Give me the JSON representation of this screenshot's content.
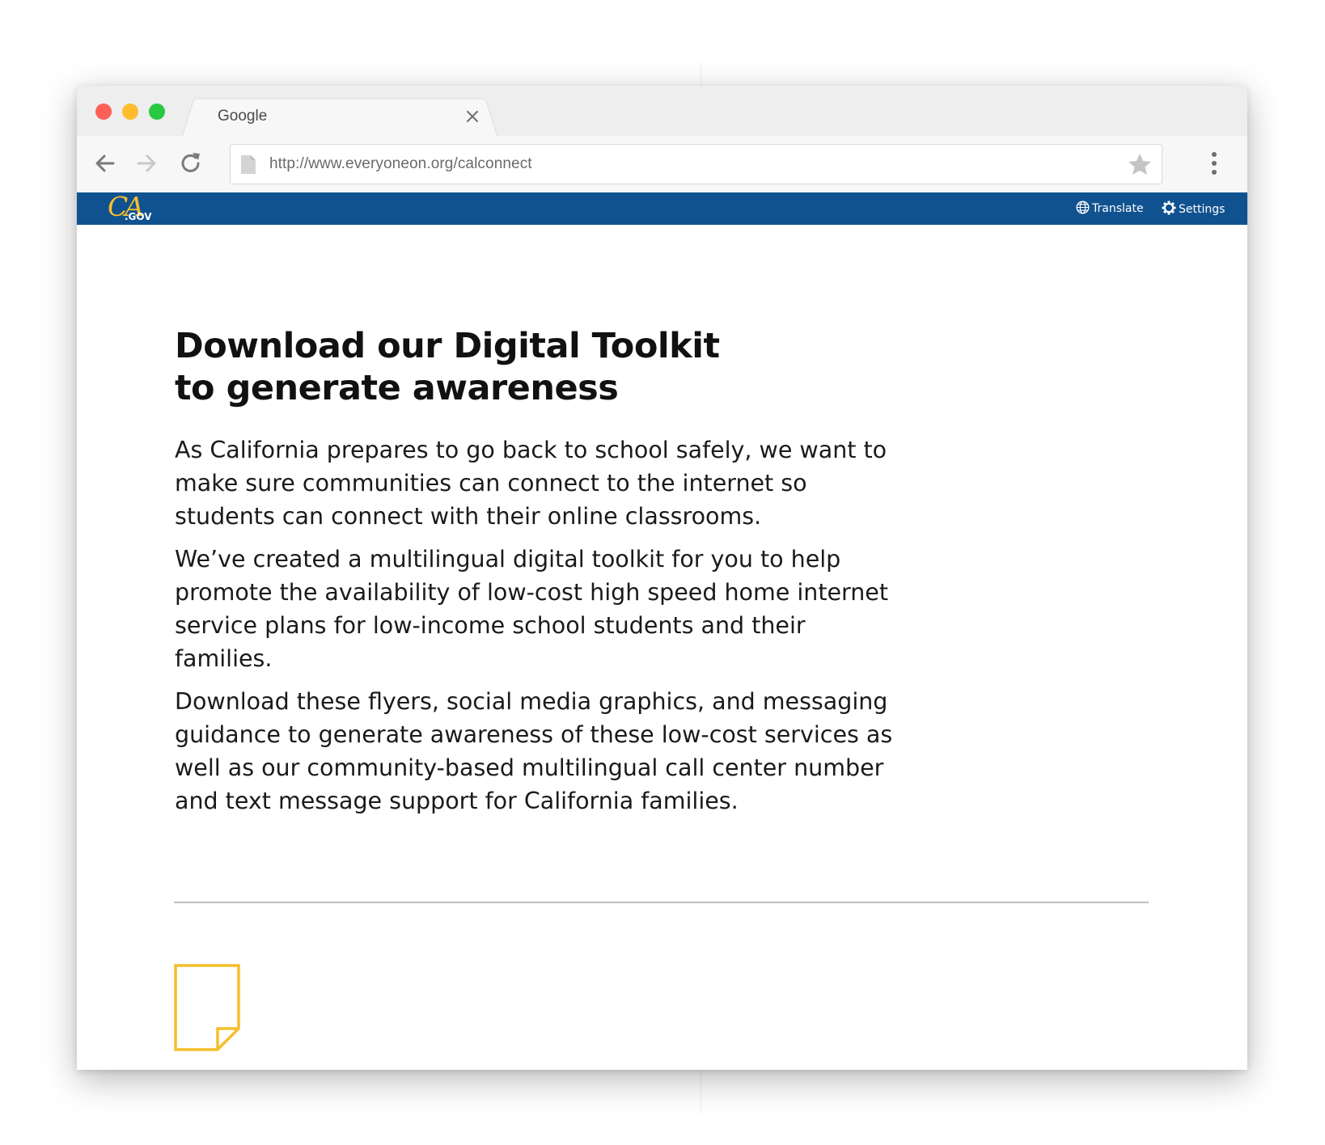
{
  "browser": {
    "tab_title": "Google",
    "url": "http://www.everyoneon.org/calconnect"
  },
  "site_header": {
    "logo_mark": "CA",
    "logo_suffix": ".GOV",
    "translate_label": "Translate",
    "settings_label": "Settings"
  },
  "main": {
    "headline_line1": "Download our Digital Toolkit",
    "headline_line2": "to generate awareness",
    "paragraphs": [
      "As California prepares to go back to school safely, we want to make sure communities can connect to the internet so students can connect with their online classrooms.",
      "We’ve created a multilingual digital toolkit for you to help promote the availability of low-cost high speed home internet service plans for low-income school students and their families.",
      "Download these flyers, social media graphics, and messaging guidance to generate awareness of these low-cost services as well as our community-based multilingual call center number and text message support for California families."
    ]
  },
  "icons": {
    "tab_close": "close-icon",
    "back": "arrow-left-icon",
    "forward": "arrow-right-icon",
    "reload": "reload-icon",
    "page": "page-icon",
    "bookmark": "star-icon",
    "menu": "more-vertical-icon",
    "translate": "globe-icon",
    "settings": "gear-icon",
    "document": "document-icon"
  },
  "colors": {
    "header_blue": "#10528f",
    "logo_gold": "#f6be2c",
    "document_icon": "#f6be2c",
    "traffic_red": "#fe5f57",
    "traffic_yellow": "#febc2e",
    "traffic_green": "#28c840"
  }
}
